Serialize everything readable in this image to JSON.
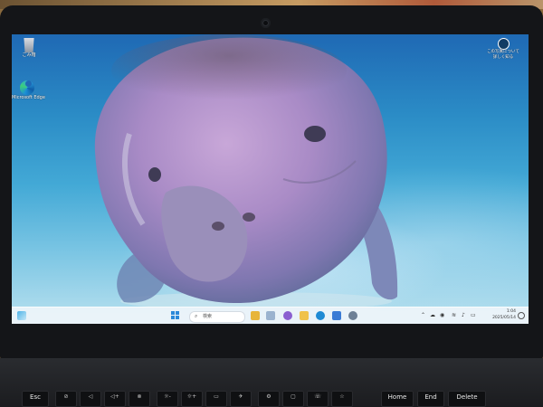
{
  "desktop": {
    "icons": [
      {
        "label": "ごみ箱",
        "icon": "recycle-bin-icon"
      },
      {
        "label": "Microsoft Edge",
        "icon": "edge-icon"
      }
    ],
    "spotlight": {
      "label_line1": "この写真について",
      "label_line2": "詳しく知る",
      "icon": "spotlight-icon"
    }
  },
  "taskbar": {
    "search_placeholder": "検索",
    "apps": [
      {
        "name": "file-explorer",
        "color": "#e7b53b"
      },
      {
        "name": "copilot",
        "color": "#8b5fd0"
      },
      {
        "name": "file-folder",
        "color": "#f0c24a"
      },
      {
        "name": "edge",
        "color": "#1f8ad4"
      },
      {
        "name": "store",
        "color": "#3a7bd5"
      },
      {
        "name": "settings",
        "color": "#6d8096"
      }
    ],
    "clock": {
      "time": "1:04",
      "date": "2025/05/14"
    }
  },
  "keyboard": {
    "keys": [
      "Esc",
      "",
      "",
      "",
      "",
      "",
      "",
      "",
      "",
      "",
      "",
      "",
      "",
      "Home",
      "End",
      "Delete"
    ]
  }
}
